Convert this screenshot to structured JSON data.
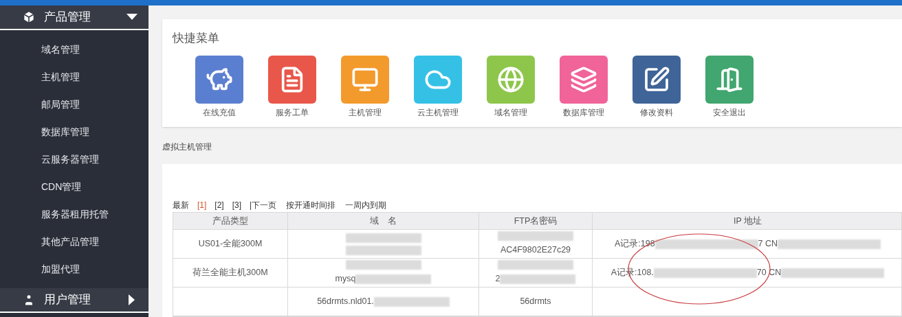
{
  "sidebar": {
    "sections": [
      {
        "title": "产品管理",
        "expanded": true,
        "items": [
          "域名管理",
          "主机管理",
          "邮局管理",
          "数据库管理",
          "云服务器管理",
          "CDN管理",
          "服务器租用托管",
          "其他产品管理",
          "加盟代理"
        ]
      },
      {
        "title": "用户管理",
        "expanded": false
      }
    ]
  },
  "quick_menu": {
    "title": "快捷菜单",
    "items": [
      {
        "label": "在线充值",
        "color": "#5b7fd0"
      },
      {
        "label": "服务工单",
        "color": "#e8574a"
      },
      {
        "label": "主机管理",
        "color": "#f39a2c"
      },
      {
        "label": "云主机管理",
        "color": "#35c1e6"
      },
      {
        "label": "域名管理",
        "color": "#8ec64c"
      },
      {
        "label": "数据库管理",
        "color": "#f0649a"
      },
      {
        "label": "修改资料",
        "color": "#3f6497"
      },
      {
        "label": "安全退出",
        "color": "#41a66f"
      }
    ]
  },
  "section_title": "虚拟主机管理",
  "pager": {
    "items": [
      {
        "label": "最新",
        "kind": "text"
      },
      {
        "label": "[1]",
        "kind": "page",
        "selected": true
      },
      {
        "label": "[2]",
        "kind": "page",
        "selected": false
      },
      {
        "label": "[3]",
        "kind": "page",
        "selected": false
      },
      {
        "label": "|下一页",
        "kind": "link"
      },
      {
        "label": "按开通时间排",
        "kind": "link"
      },
      {
        "label": "一周内到期",
        "kind": "link"
      }
    ]
  },
  "table": {
    "columns": [
      "产品类型",
      "域　名",
      "FTP名密码",
      "IP 地址"
    ],
    "rows": [
      [
        [
          {
            "kind": "text",
            "text": "US01-全能300M"
          }
        ],
        [
          {
            "kind": "redacted"
          },
          {
            "kind": "break"
          },
          {
            "kind": "redacted"
          }
        ],
        [
          {
            "kind": "redacted"
          },
          {
            "kind": "break"
          },
          {
            "kind": "text",
            "text": "AC4F9802E27c29"
          }
        ],
        [
          {
            "kind": "text",
            "text": "A记录:198"
          },
          {
            "kind": "redacted"
          },
          {
            "kind": "text",
            "text": "7 CN"
          },
          {
            "kind": "redacted"
          }
        ]
      ],
      [
        [
          {
            "kind": "text",
            "text": "荷兰全能主机300M"
          }
        ],
        [
          {
            "kind": "redacted"
          },
          {
            "kind": "break"
          },
          {
            "kind": "text",
            "text": "mysq"
          },
          {
            "kind": "redacted"
          }
        ],
        [
          {
            "kind": "redacted"
          },
          {
            "kind": "break"
          },
          {
            "kind": "text",
            "text": "2"
          },
          {
            "kind": "redacted"
          }
        ],
        [
          {
            "kind": "text",
            "text": "A记录:108."
          },
          {
            "kind": "redacted"
          },
          {
            "kind": "text",
            "text": "70 CN"
          },
          {
            "kind": "redacted"
          }
        ]
      ],
      [
        [],
        [
          {
            "kind": "text",
            "text": "56drmts.nld01."
          },
          {
            "kind": "redacted"
          }
        ],
        [
          {
            "kind": "text",
            "text": "56drmts"
          }
        ],
        []
      ]
    ]
  }
}
